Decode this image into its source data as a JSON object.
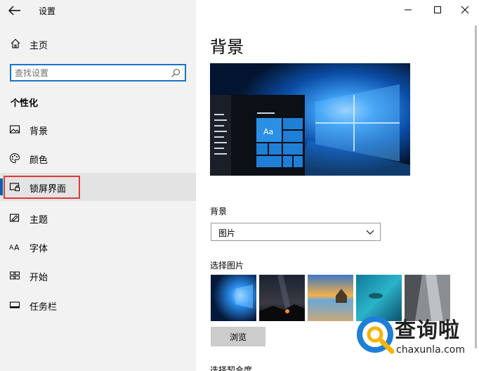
{
  "app": {
    "title": "设置"
  },
  "sidebar": {
    "home_label": "主页",
    "search_placeholder": "查找设置",
    "section_title": "个性化",
    "items": [
      {
        "label": "背景",
        "icon": "picture-icon"
      },
      {
        "label": "颜色",
        "icon": "palette-icon"
      },
      {
        "label": "锁屏界面",
        "icon": "lock-screen-icon"
      },
      {
        "label": "主题",
        "icon": "theme-icon"
      },
      {
        "label": "字体",
        "icon": "font-icon"
      },
      {
        "label": "开始",
        "icon": "start-icon"
      },
      {
        "label": "任务栏",
        "icon": "taskbar-icon"
      }
    ],
    "active_item": "锁屏界面"
  },
  "content": {
    "page_title": "背景",
    "preview_sample_text": "Aa",
    "background_label": "背景",
    "background_value": "图片",
    "choose_picture_label": "选择图片",
    "browse_label": "浏览",
    "fit_label": "选择契合度"
  },
  "watermark": {
    "brand": "查询啦",
    "url": "chaxunla.com"
  },
  "colors": {
    "accent": "#0063b1",
    "highlight_border": "#e0393a",
    "search_border": "#1a73c8"
  }
}
